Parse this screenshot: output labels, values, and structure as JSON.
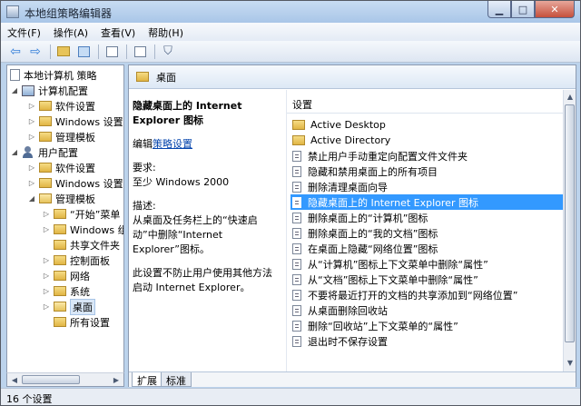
{
  "window": {
    "title": "本地组策略编辑器"
  },
  "menubar": {
    "items": [
      {
        "label": "文件(F)"
      },
      {
        "label": "操作(A)"
      },
      {
        "label": "查看(V)"
      },
      {
        "label": "帮助(H)"
      }
    ]
  },
  "tree": {
    "root": "本地计算机 策略",
    "computer_config": "计算机配置",
    "cc_software": "软件设置",
    "cc_windows": "Windows 设置",
    "cc_admin": "管理模板",
    "user_config": "用户配置",
    "uc_software": "软件设置",
    "uc_windows": "Windows 设置",
    "uc_admin": "管理模板",
    "start_menu": "“开始”菜单",
    "windows_components": "Windows 组件",
    "shared_folders": "共享文件夹",
    "control_panel": "控制面板",
    "network": "网络",
    "system": "系统",
    "desktop": "桌面",
    "all_settings": "所有设置"
  },
  "right": {
    "header": "桌面",
    "extended": {
      "title": "隐藏桌面上的 Internet Explorer 图标",
      "edit_prefix": "编辑",
      "edit_link": "策略设置",
      "req_label": "要求:",
      "req_value": "至少 Windows 2000",
      "desc_label": "描述:",
      "desc_text": "从桌面及任务栏上的“快速启动”中删除“Internet Explorer”图标。",
      "desc_text2": "此设置不防止用户使用其他方法启动 Internet Explorer。"
    },
    "list_header": "设置",
    "rows": [
      {
        "label": "Active Desktop",
        "kind": "folder"
      },
      {
        "label": "Active Directory",
        "kind": "folder"
      },
      {
        "label": "禁止用户手动重定向配置文件文件夹",
        "kind": "setting"
      },
      {
        "label": "隐藏和禁用桌面上的所有项目",
        "kind": "setting"
      },
      {
        "label": "删除清理桌面向导",
        "kind": "setting"
      },
      {
        "label": "隐藏桌面上的 Internet Explorer 图标",
        "kind": "setting"
      },
      {
        "label": "删除桌面上的“计算机”图标",
        "kind": "setting"
      },
      {
        "label": "删除桌面上的“我的文档”图标",
        "kind": "setting"
      },
      {
        "label": "在桌面上隐藏“网络位置”图标",
        "kind": "setting"
      },
      {
        "label": "从“计算机”图标上下文菜单中删除“属性”",
        "kind": "setting"
      },
      {
        "label": "从“文档”图标上下文菜单中删除“属性”",
        "kind": "setting"
      },
      {
        "label": "不要将最近打开的文档的共享添加到“网络位置”",
        "kind": "setting"
      },
      {
        "label": "从桌面删除回收站",
        "kind": "setting"
      },
      {
        "label": "删除“回收站”上下文菜单的“属性”",
        "kind": "setting"
      },
      {
        "label": "退出时不保存设置",
        "kind": "setting"
      }
    ],
    "tabs": {
      "extended": "扩展",
      "standard": "标准"
    }
  },
  "status": {
    "text": "16 个设置"
  }
}
